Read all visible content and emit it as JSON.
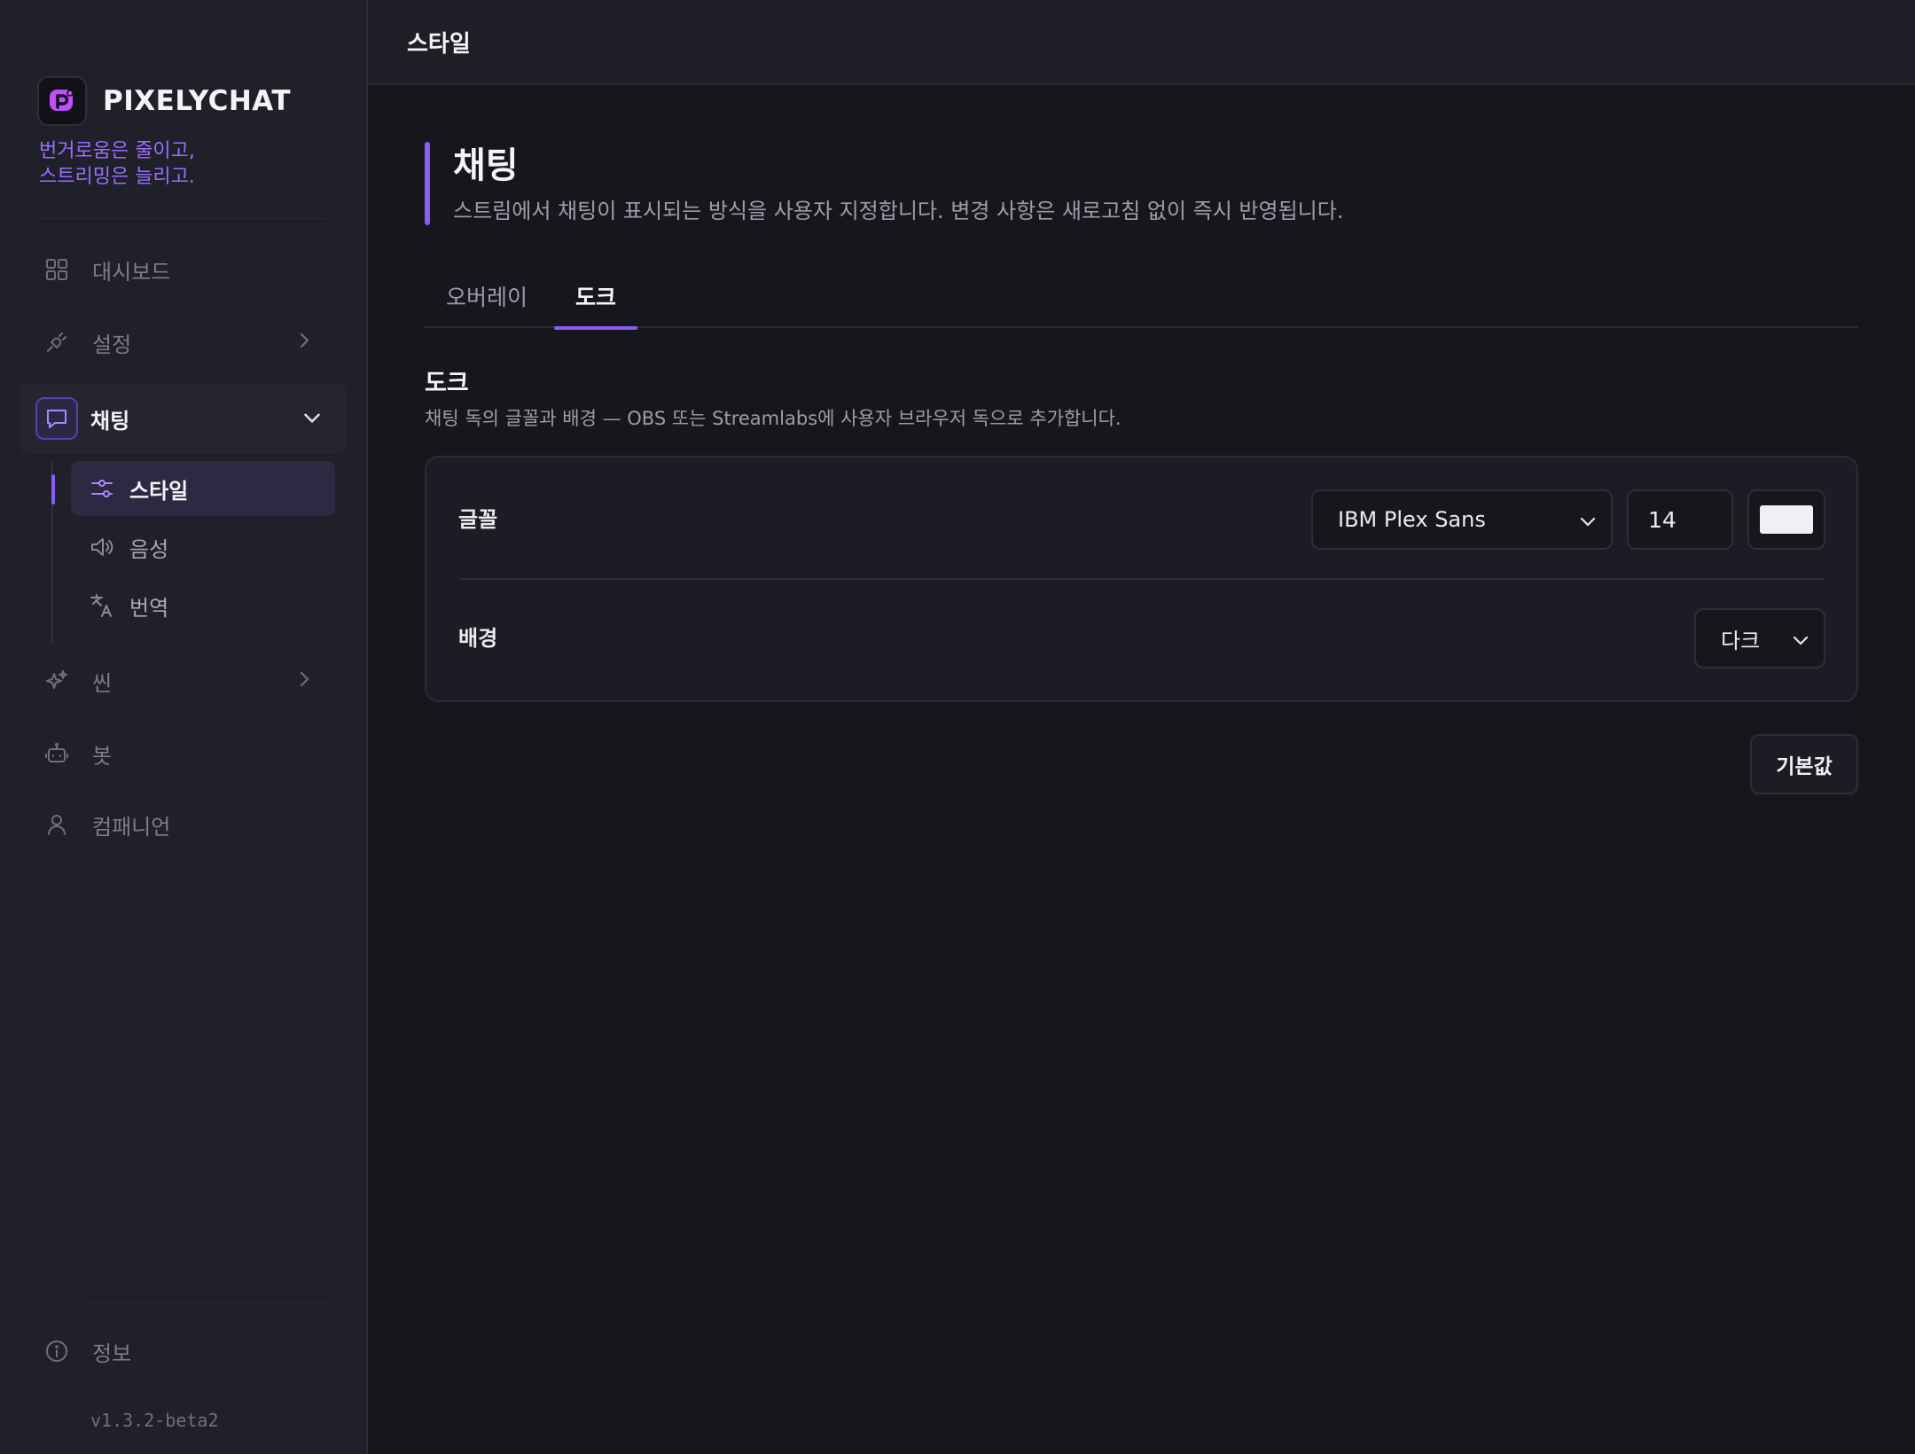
{
  "brand": {
    "name": "PIXELYCHAT",
    "tagline_line1": "번거로움은 줄이고,",
    "tagline_line2": "스트리밍은 늘리고.",
    "accent_color": "#8b5cf6"
  },
  "sidebar": {
    "items": [
      {
        "label": "대시보드",
        "icon": "grid-icon"
      },
      {
        "label": "설정",
        "icon": "plug-icon"
      },
      {
        "label": "채팅",
        "icon": "chat-bubble-icon"
      },
      {
        "label": "씬",
        "icon": "sparkles-icon"
      },
      {
        "label": "봇",
        "icon": "bot-icon"
      },
      {
        "label": "컴패니언",
        "icon": "person-icon"
      }
    ],
    "chat_sub": [
      {
        "label": "스타일",
        "icon": "sliders-icon"
      },
      {
        "label": "음성",
        "icon": "speaker-icon"
      },
      {
        "label": "번역",
        "icon": "translate-icon"
      }
    ],
    "info_label": "정보",
    "version": "v1.3.2-beta2"
  },
  "topbar": {
    "title": "스타일"
  },
  "page": {
    "title": "채팅",
    "description": "스트림에서 채팅이 표시되는 방식을 사용자 지정합니다. 변경 사항은 새로고침 없이 즉시 반영됩니다."
  },
  "tabs": [
    {
      "label": "오버레이"
    },
    {
      "label": "도크"
    }
  ],
  "section": {
    "title": "도크",
    "description": "채팅 독의 글꼴과 배경 — OBS 또는 Streamlabs에 사용자 브라우저 독으로 추가합니다."
  },
  "settings": {
    "font_label": "글꼴",
    "font_family": "IBM Plex Sans",
    "font_size": "14",
    "font_color": "#eef0f4",
    "background_label": "배경",
    "background_value": "다크"
  },
  "actions": {
    "reset_label": "기본값"
  }
}
